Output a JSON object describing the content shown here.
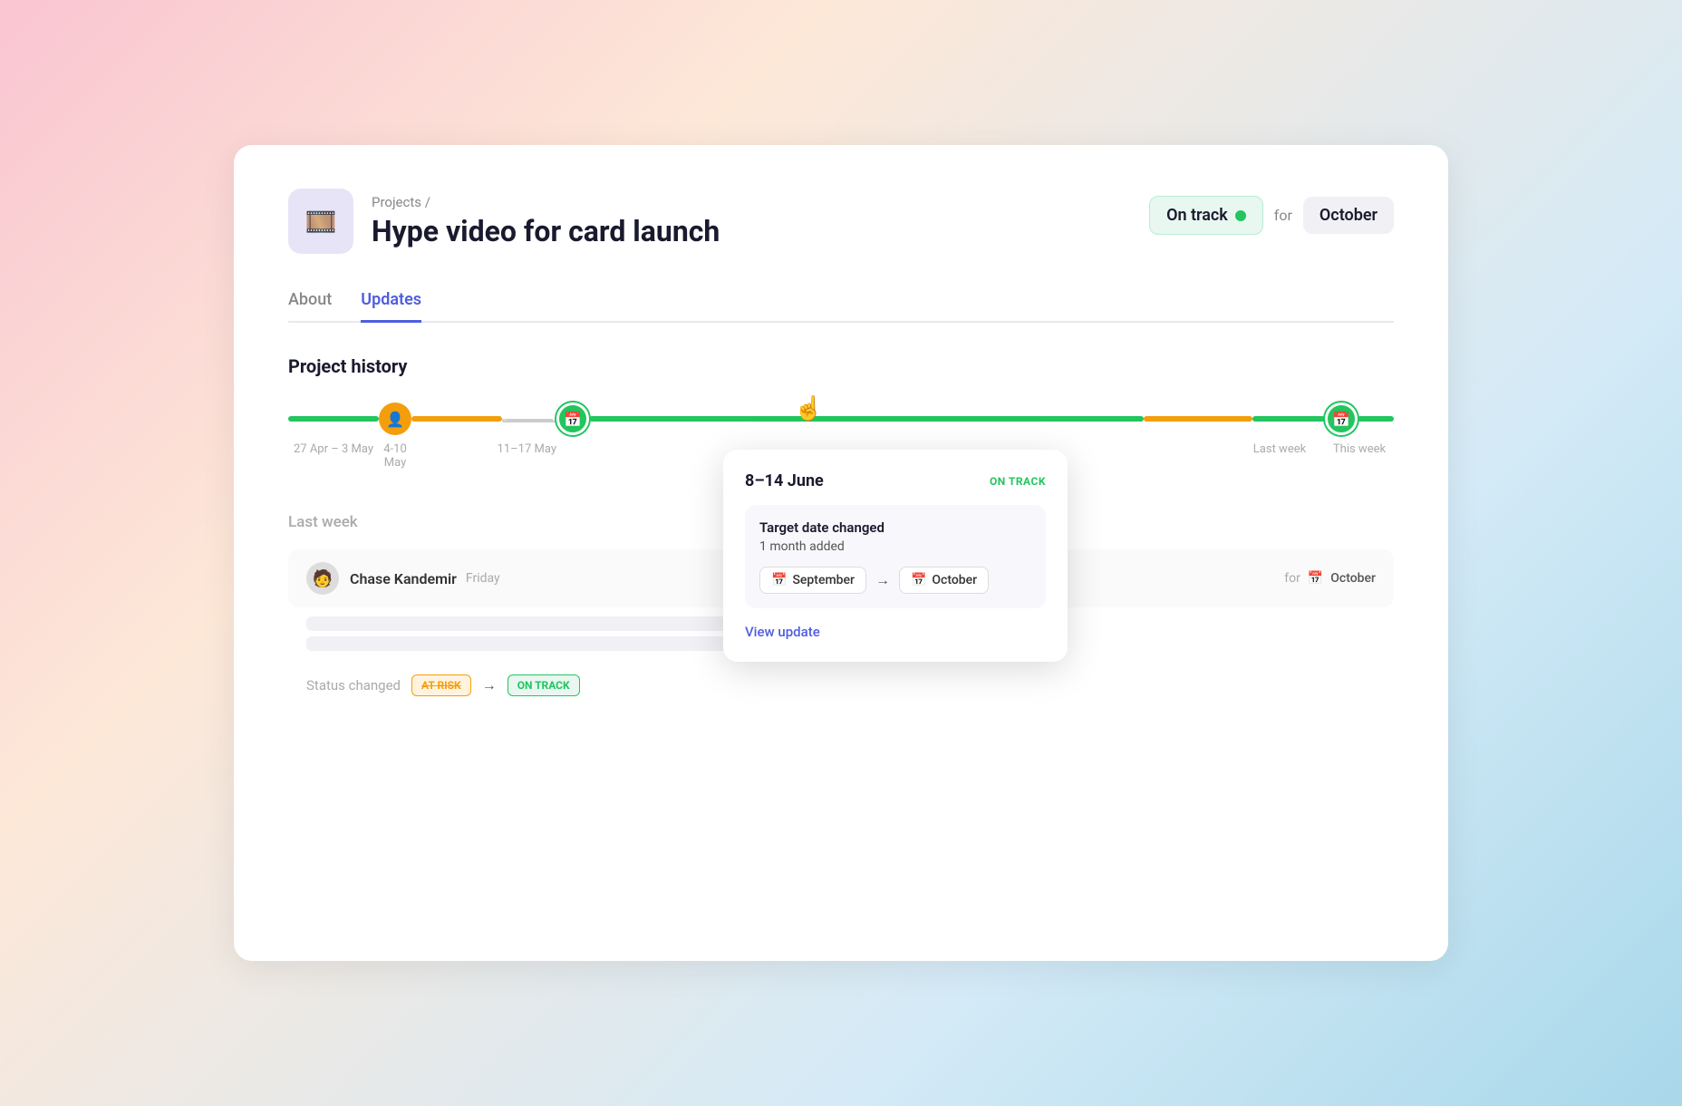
{
  "header": {
    "breadcrumb": "Projects /",
    "project_title": "Hype video for card launch",
    "status_label": "On track",
    "for_label": "for",
    "month_label": "October",
    "project_icon": "🎞️"
  },
  "tabs": [
    {
      "label": "About",
      "active": false
    },
    {
      "label": "Updates",
      "active": true
    }
  ],
  "section": {
    "history_title": "Project history"
  },
  "timeline": {
    "nodes": [
      {
        "label": "27 Apr – 3 May",
        "type": "none"
      },
      {
        "label": "4-10 May",
        "type": "orange",
        "icon": "👤"
      },
      {
        "label": "11–17 May",
        "type": "none"
      },
      {
        "label": "8–14 June",
        "type": "green",
        "icon": "📅"
      },
      {
        "label": "",
        "type": "none"
      },
      {
        "label": "Last week",
        "type": "green"
      },
      {
        "label": "This week",
        "type": "green",
        "icon": "📅"
      }
    ]
  },
  "popup": {
    "date_range": "8–14 June",
    "status": "ON TRACK",
    "change_title": "Target date changed",
    "change_sub": "1 month added",
    "from_month": "September",
    "to_month": "October",
    "view_link": "View update"
  },
  "last_week": {
    "title": "Last week",
    "update": {
      "name": "Chase Kandemir",
      "time": "Friday",
      "status_from": "AT RISK",
      "status_to": "ON TRACK",
      "for_label": "for",
      "month": "October",
      "status_changed_label": "Status changed"
    }
  }
}
